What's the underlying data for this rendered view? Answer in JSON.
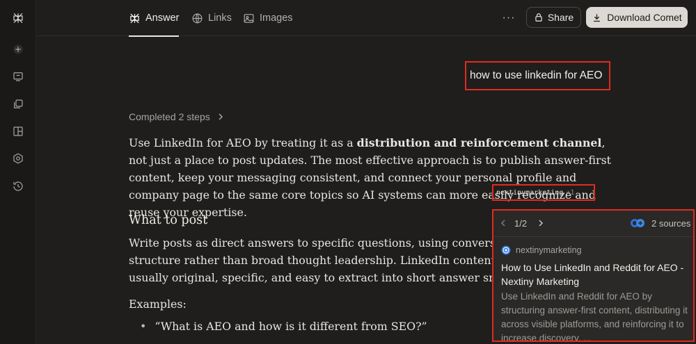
{
  "sidebar": {
    "items": [
      {
        "icon": "logo-icon"
      },
      {
        "icon": "new-thread-icon"
      },
      {
        "icon": "home-icon"
      },
      {
        "icon": "spaces-icon"
      },
      {
        "icon": "library-icon"
      },
      {
        "icon": "discover-icon"
      },
      {
        "icon": "history-icon"
      }
    ]
  },
  "tabs": [
    {
      "label": "Answer",
      "icon": "answer-icon",
      "active": true
    },
    {
      "label": "Links",
      "icon": "globe-icon",
      "active": false
    },
    {
      "label": "Images",
      "icon": "image-icon",
      "active": false
    }
  ],
  "header": {
    "more": "···",
    "share_label": "Share",
    "download_label": "Download Comet"
  },
  "query": "how to use linkedin for AEO",
  "steps": {
    "label": "Completed 2 steps"
  },
  "answer": {
    "intro_1": "Use LinkedIn for AEO by treating it as a ",
    "intro_bold": "distribution and reinforcement channel",
    "intro_2": ", not just a place to post updates. The most effective approach is to publish answer-first content, keep your messaging consistent, and connect your personal profile and company page to the same core topics so AI systems can more easily recognize and reuse your expertise.",
    "citation": {
      "source": "nextinymarketing",
      "extra": "+1"
    },
    "heading": "What to post",
    "para_lines": [
      "Write posts as direct answers to specific questions, using conversational",
      "structure rather than broad thought leadership. LinkedIn content that w",
      "usually original, specific, and easy to extract into short answer snippets."
    ],
    "examples_label": "Examples:",
    "bullets": [
      "“What is AEO and how is it different from SEO?”"
    ]
  },
  "popover": {
    "page": "1/2",
    "sources_label": "2 sources",
    "site": "nextinymarketing",
    "title": "How to Use LinkedIn and Reddit for AEO - Nextiny Marketing",
    "description": "Use LinkedIn and Reddit for AEO by structuring answer-first content, distributing it across visible platforms, and reinforcing it to increase discovery, ..."
  },
  "colors": {
    "background": "#1f1e1d",
    "highlight_box": "#e02b20",
    "button_light": "#dcd9d4"
  }
}
